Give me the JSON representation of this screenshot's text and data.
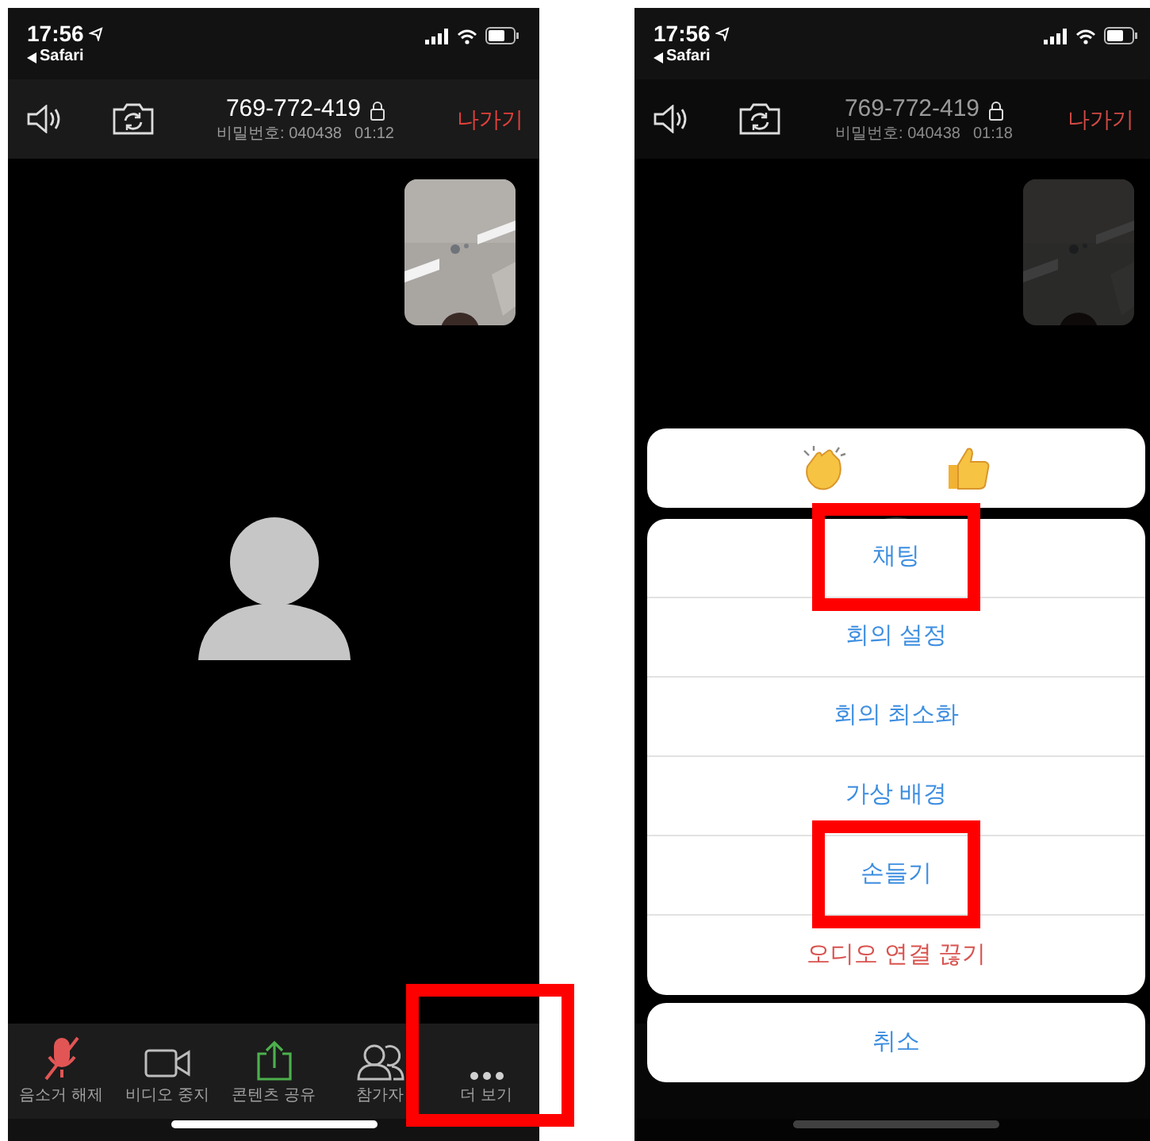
{
  "screens": [
    {
      "dimmed": false,
      "status_bar": {
        "time": "17:56",
        "back_label": "Safari"
      },
      "top_bar": {
        "meeting_id": "769-772-419",
        "password": "비밀번호: 040438",
        "duration": "01:12",
        "leave": "나가기"
      },
      "toolbar_buttons": [
        {
          "kind": "unmute",
          "label": "음소거 해제",
          "highlighted": false
        },
        {
          "kind": "video",
          "label": "비디오 중지",
          "highlighted": false
        },
        {
          "kind": "share",
          "label": "콘텐츠 공유",
          "highlighted": false
        },
        {
          "kind": "participants",
          "label": "참가자",
          "highlighted": false
        },
        {
          "kind": "more",
          "label": "더 보기",
          "highlighted": true
        }
      ]
    },
    {
      "dimmed": true,
      "status_bar": {
        "time": "17:56",
        "back_label": "Safari"
      },
      "top_bar": {
        "meeting_id": "769-772-419",
        "password": "비밀번호: 040438",
        "duration": "01:18",
        "leave": "나가기"
      },
      "action_sheet": {
        "reactions": [
          {
            "kind": "clap"
          },
          {
            "kind": "thumbs_up"
          }
        ],
        "items": [
          {
            "label": "채팅",
            "kind": "normal",
            "highlighted": true
          },
          {
            "label": "회의 설정",
            "kind": "normal",
            "highlighted": false
          },
          {
            "label": "회의 최소화",
            "kind": "normal",
            "highlighted": false
          },
          {
            "label": "가상 배경",
            "kind": "normal",
            "highlighted": false
          },
          {
            "label": "손들기",
            "kind": "normal",
            "highlighted": true
          },
          {
            "label": "오디오 연결 끊기",
            "kind": "destructive",
            "highlighted": false
          }
        ],
        "cancel": "취소"
      }
    }
  ]
}
